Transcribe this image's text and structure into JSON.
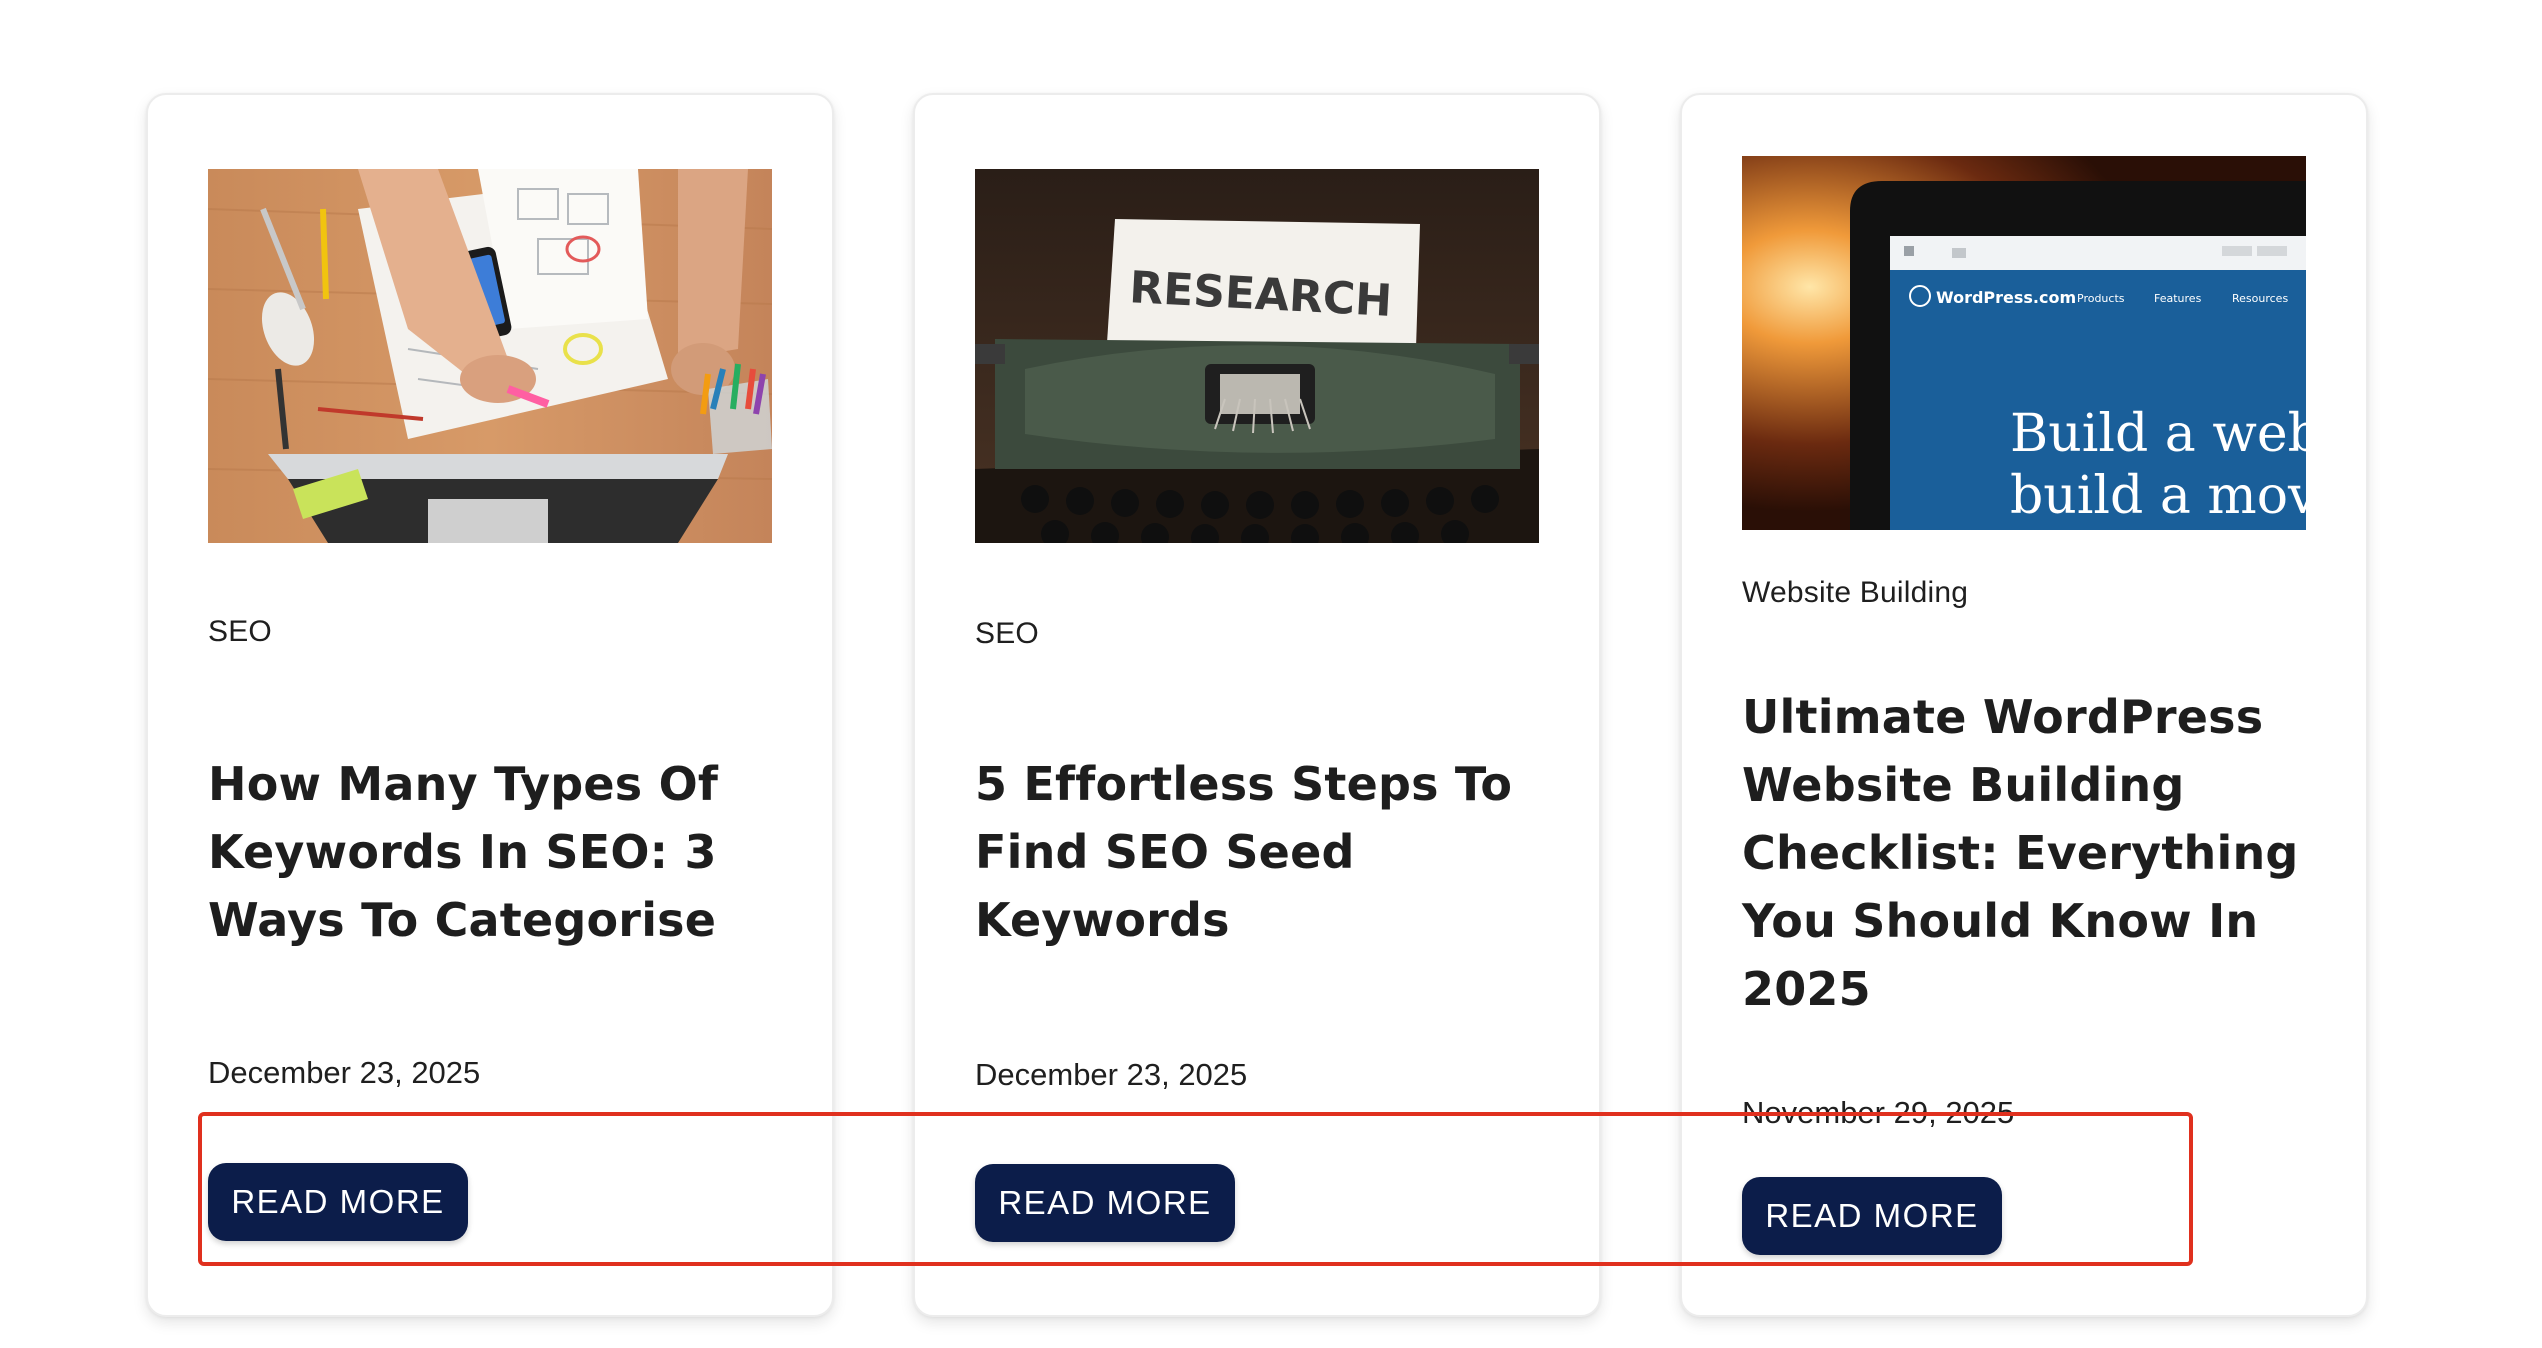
{
  "cards": [
    {
      "category": "SEO",
      "title": "How Many Types Of Keywords In SEO: 3 Ways To Categorise",
      "date": "December 23, 2025",
      "button_label": "READ MORE",
      "image_icon": "desk-planning-photo"
    },
    {
      "category": "SEO",
      "title": "5 Effortless Steps To Find SEO Seed Keywords",
      "date": "December 23, 2025",
      "button_label": "READ MORE",
      "image_icon": "typewriter-research-photo",
      "image_text": "RESEARCH"
    },
    {
      "category": "Website Building",
      "title": "Ultimate WordPress Website Building Checklist: Everything You Should Know In 2025",
      "date": "November 29, 2025",
      "button_label": "READ MORE",
      "image_icon": "wordpress-laptop-photo",
      "image_text": {
        "brand": "WordPress.com",
        "nav": [
          "Products",
          "Features",
          "Resources"
        ],
        "headline_1": "Build a webs",
        "headline_2": "build a move"
      }
    }
  ],
  "colors": {
    "button_bg": "#0c1d4a",
    "highlight": "#e0301e"
  }
}
